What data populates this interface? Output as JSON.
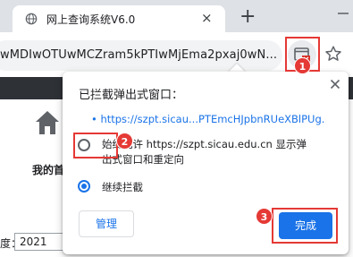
{
  "browser": {
    "tab_title": "网上查询系统V6.0",
    "tab_close_glyph": "×",
    "new_tab_glyph": "+",
    "url": "wMDIwOTUwMCZram5kPTIwMjEma2pxaj0wN..."
  },
  "page": {
    "home_label": "我的首",
    "year_label": "度：",
    "year_value": "2021"
  },
  "dialog": {
    "title": "已拦截弹出式窗口：",
    "blocked_link": "https://szpt.sicau...PTEmcHJpbnRUeXBlPUg.",
    "allow_option": "始终允许 https://szpt.sicau.edu.cn 显示弹出式窗口和重定向",
    "block_option": "继续拦截",
    "manage_label": "管理",
    "done_label": "完成",
    "selected_option": "block"
  },
  "annotations": {
    "badge_1": "1",
    "badge_2": "2",
    "badge_3": "3"
  },
  "colors": {
    "accent": "#1a73e8",
    "annotation": "#e53935",
    "page_header": "#2e3136"
  }
}
